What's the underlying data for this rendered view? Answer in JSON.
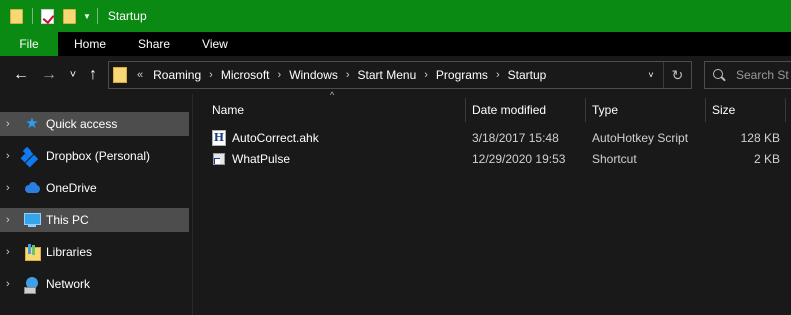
{
  "window": {
    "title": "Startup"
  },
  "ribbon": {
    "tabs": [
      "File",
      "Home",
      "Share",
      "View"
    ]
  },
  "nav": {
    "back": "←",
    "forward": "→",
    "recent": "˅",
    "up": "↑"
  },
  "address": {
    "overflow": "«",
    "separator": "›",
    "crumbs": [
      "Roaming",
      "Microsoft",
      "Windows",
      "Start Menu",
      "Programs",
      "Startup"
    ],
    "dropdown": "˅",
    "refresh": "↻"
  },
  "search": {
    "placeholder": "Search St"
  },
  "sidebar": {
    "items": [
      {
        "label": "Quick access",
        "icon": "star-icon",
        "selected": true
      },
      {
        "label": "Dropbox (Personal)",
        "icon": "dropbox-icon",
        "selected": false
      },
      {
        "label": "OneDrive",
        "icon": "onedrive-icon",
        "selected": false
      },
      {
        "label": "This PC",
        "icon": "this-pc-icon",
        "selected": true
      },
      {
        "label": "Libraries",
        "icon": "libraries-icon",
        "selected": false
      },
      {
        "label": "Network",
        "icon": "network-icon",
        "selected": false
      }
    ],
    "chevron": "›"
  },
  "files": {
    "sort_indicator": "^",
    "columns": [
      "Name",
      "Date modified",
      "Type",
      "Size"
    ],
    "rows": [
      {
        "name": "AutoCorrect.ahk",
        "date": "3/18/2017 15:48",
        "type": "AutoHotkey Script",
        "size": "128 KB",
        "icon": "autohotkey-file-icon",
        "icon_glyph": "H"
      },
      {
        "name": "WhatPulse",
        "date": "12/29/2020 19:53",
        "type": "Shortcut",
        "size": "2 KB",
        "icon": "shortcut-icon"
      }
    ]
  },
  "colors": {
    "titlebar": "#0a8a12",
    "background": "#191919",
    "selected": "#4d4d4d",
    "text": "#ffffff"
  }
}
